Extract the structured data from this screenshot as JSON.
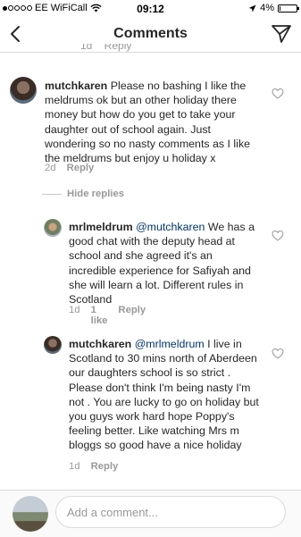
{
  "status_bar": {
    "carrier": "EE WiFiCall",
    "time": "09:12",
    "battery": "4%",
    "battery_level": 0.04
  },
  "nav": {
    "title": "Comments"
  },
  "comments": [
    {
      "username": "mutchkaren",
      "mention": "",
      "text": "Please no bashing I like the meldrums ok but an other holiday there money but how do you get to take your daughter out of school again. Just wondering so no nasty comments as I like the meldrums but enjoy u holiday x",
      "age": "2d",
      "likes": "",
      "reply_label": "Reply"
    },
    {
      "username": "mrlmeldrum",
      "mention": "@mutchkaren",
      "text": "We has a good chat with the deputy head at school and she agreed it's an incredible experience for Safiyah and she will learn a lot. Different rules in Scotland",
      "age": "1d",
      "likes": "1 like",
      "reply_label": "Reply"
    },
    {
      "username": "mutchkaren",
      "mention": "@mrlmeldrum",
      "text": "I live in Scotland to  30 mins north of Aberdeen our daughters school is so strict . Please don't think I'm being nasty I'm not . You are lucky to go on holiday but you guys work hard hope Poppy's feeling better. Like watching Mrs m bloggs so good have a nice holiday",
      "age": "1d",
      "likes": "",
      "reply_label": "Reply"
    }
  ],
  "hide_replies": "Hide replies",
  "composer": {
    "placeholder": "Add a comment..."
  },
  "icons": {
    "back": "chevron-left-icon",
    "send": "paper-plane-icon",
    "like": "heart-icon",
    "wifi": "wifi-icon",
    "location": "location-arrow-icon"
  }
}
